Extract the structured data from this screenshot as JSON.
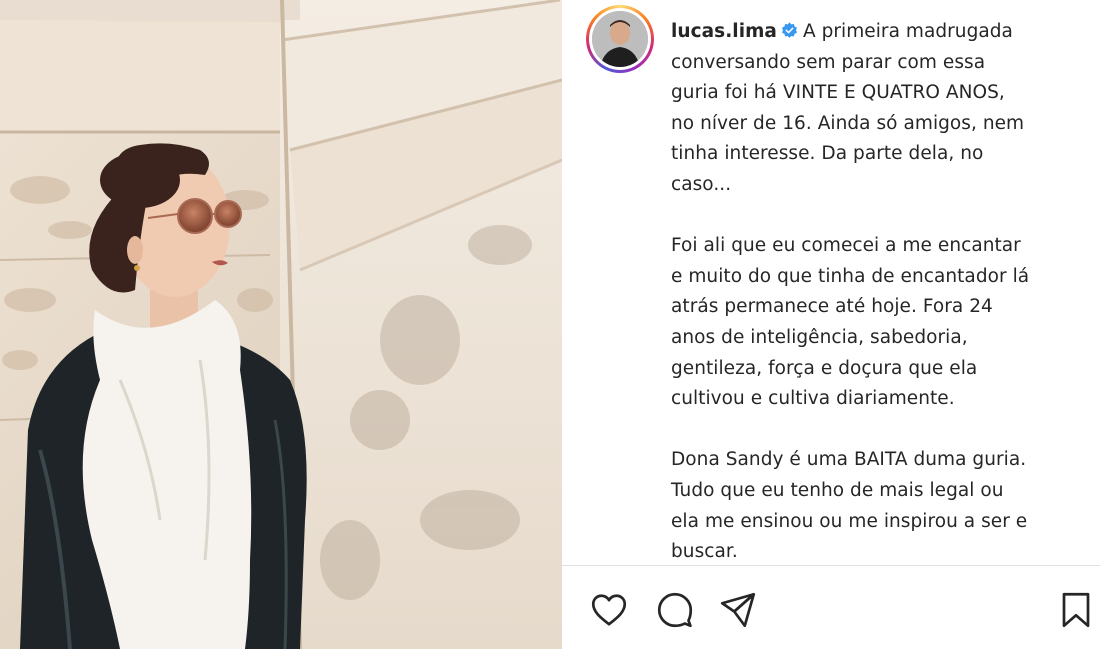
{
  "post": {
    "username": "lucas.lima",
    "verified_icon": "verified-badge-icon",
    "caption_lines": [
      "A primeira madrugada",
      "conversando sem parar com essa",
      "guria foi há VINTE E QUATRO ANOS,",
      "no níver de 16. Ainda só amigos, nem",
      "tinha interesse. Da parte dela, no",
      "caso...",
      "",
      "Foi ali que eu comecei a me encantar",
      "e muito do que tinha de encantador lá",
      "atrás permanece até hoje. Fora 24",
      "anos de inteligência, sabedoria,",
      "gentileza, força e doçura que ela",
      "cultivou e cultiva diariamente.",
      "",
      "Dona Sandy é uma BAITA duma guria.",
      "Tudo que eu tenho de mais legal ou",
      "ela me ensinou ou me inspirou a ser e",
      "buscar."
    ]
  },
  "actions": {
    "like_icon": "heart-icon",
    "comment_icon": "comment-icon",
    "share_icon": "send-icon",
    "save_icon": "bookmark-icon"
  },
  "colors": {
    "text": "#262626",
    "verified": "#3897f0",
    "divider": "#e0e0e0"
  }
}
